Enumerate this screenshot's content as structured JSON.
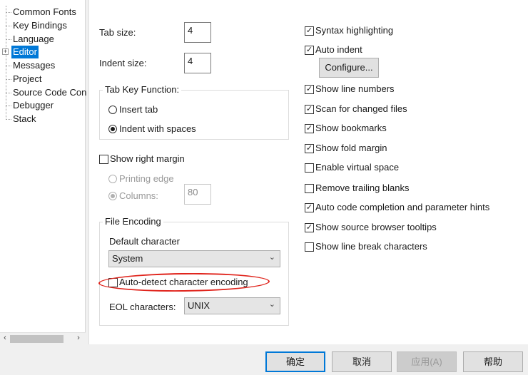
{
  "tree": {
    "items": [
      "Common Fonts",
      "Key Bindings",
      "Language",
      "Editor",
      "Messages",
      "Project",
      "Source Code Con",
      "Debugger",
      "Stack"
    ],
    "selected": "Editor",
    "expander": "+"
  },
  "editor": {
    "tab_size_label": "Tab size:",
    "tab_size_value": "4",
    "indent_size_label": "Indent size:",
    "indent_size_value": "4",
    "tab_key_group_title": "Tab Key Function:",
    "insert_tab_label": "Insert tab",
    "indent_with_spaces_label": "Indent with spaces",
    "show_right_margin_label": "Show right margin",
    "printing_edge_label": "Printing edge",
    "columns_label": "Columns:",
    "columns_value": "80",
    "file_encoding_group_title": "File Encoding",
    "default_character_label": "Default character",
    "default_character_value": "System",
    "auto_detect_label": "Auto-detect character encoding",
    "eol_label": "EOL characters:",
    "eol_value": "UNIX",
    "options": [
      {
        "label": "Syntax highlighting",
        "checked": true
      },
      {
        "label": "Auto indent",
        "checked": true
      },
      {
        "label": "Show line numbers",
        "checked": true
      },
      {
        "label": "Scan for changed files",
        "checked": true
      },
      {
        "label": "Show bookmarks",
        "checked": true
      },
      {
        "label": "Show fold margin",
        "checked": true
      },
      {
        "label": "Enable virtual space",
        "checked": false
      },
      {
        "label": "Remove trailing blanks",
        "checked": false
      },
      {
        "label": "Auto code completion and parameter hints",
        "checked": true
      },
      {
        "label": "Show source browser tooltips",
        "checked": true
      },
      {
        "label": "Show line break characters",
        "checked": false
      }
    ],
    "configure_label": "Configure..."
  },
  "footer": {
    "ok_label": "确定",
    "cancel_label": "取消",
    "apply_label": "应用(A)",
    "help_label": "帮助"
  },
  "colors": {
    "selection": "#0078d7",
    "annotation": "#e0241c"
  },
  "icons": {
    "check": "✓",
    "caret": "⌄",
    "scroll_left": "‹",
    "scroll_right": "›"
  }
}
